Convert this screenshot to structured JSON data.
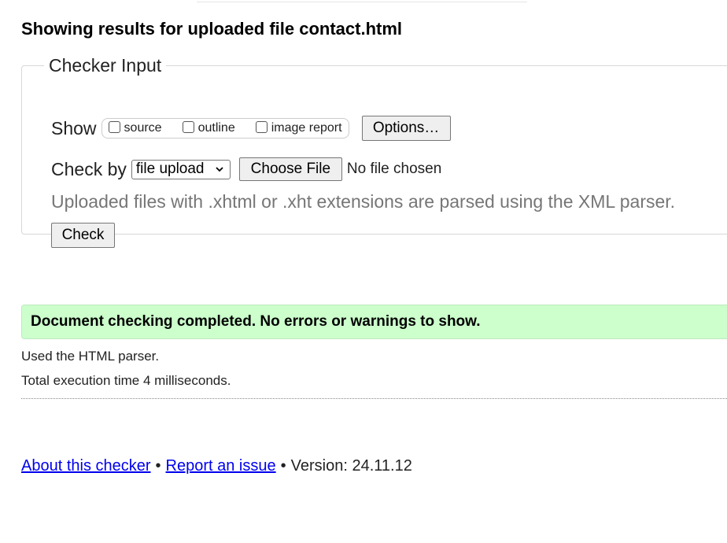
{
  "results": {
    "heading": "Showing results for uploaded file contact.html"
  },
  "checker_input": {
    "legend": "Checker Input",
    "show_label": "Show",
    "show_options": [
      {
        "label": "source",
        "checked": false
      },
      {
        "label": "outline",
        "checked": false
      },
      {
        "label": "image report",
        "checked": false
      }
    ],
    "options_button": "Options…",
    "check_by_label": "Check by",
    "check_by_selected": "file upload",
    "choose_file_button": "Choose File",
    "file_status": "No file chosen",
    "xml_note": "Uploaded files with .xhtml or .xht extensions are parsed using the XML parser.",
    "check_button": "Check"
  },
  "status": {
    "message": "Document checking completed. No errors or warnings to show.",
    "parser_line": "Used the HTML parser.",
    "time_line": "Total execution time 4 milliseconds.",
    "color": "#ccffcc"
  },
  "footer": {
    "about_link": "About this checker",
    "separator": "•",
    "report_link": "Report an issue",
    "version": "Version: 24.11.12",
    "link_color": "#0000ee"
  },
  "icons": {
    "select_arrow": "chevron-down-icon"
  }
}
